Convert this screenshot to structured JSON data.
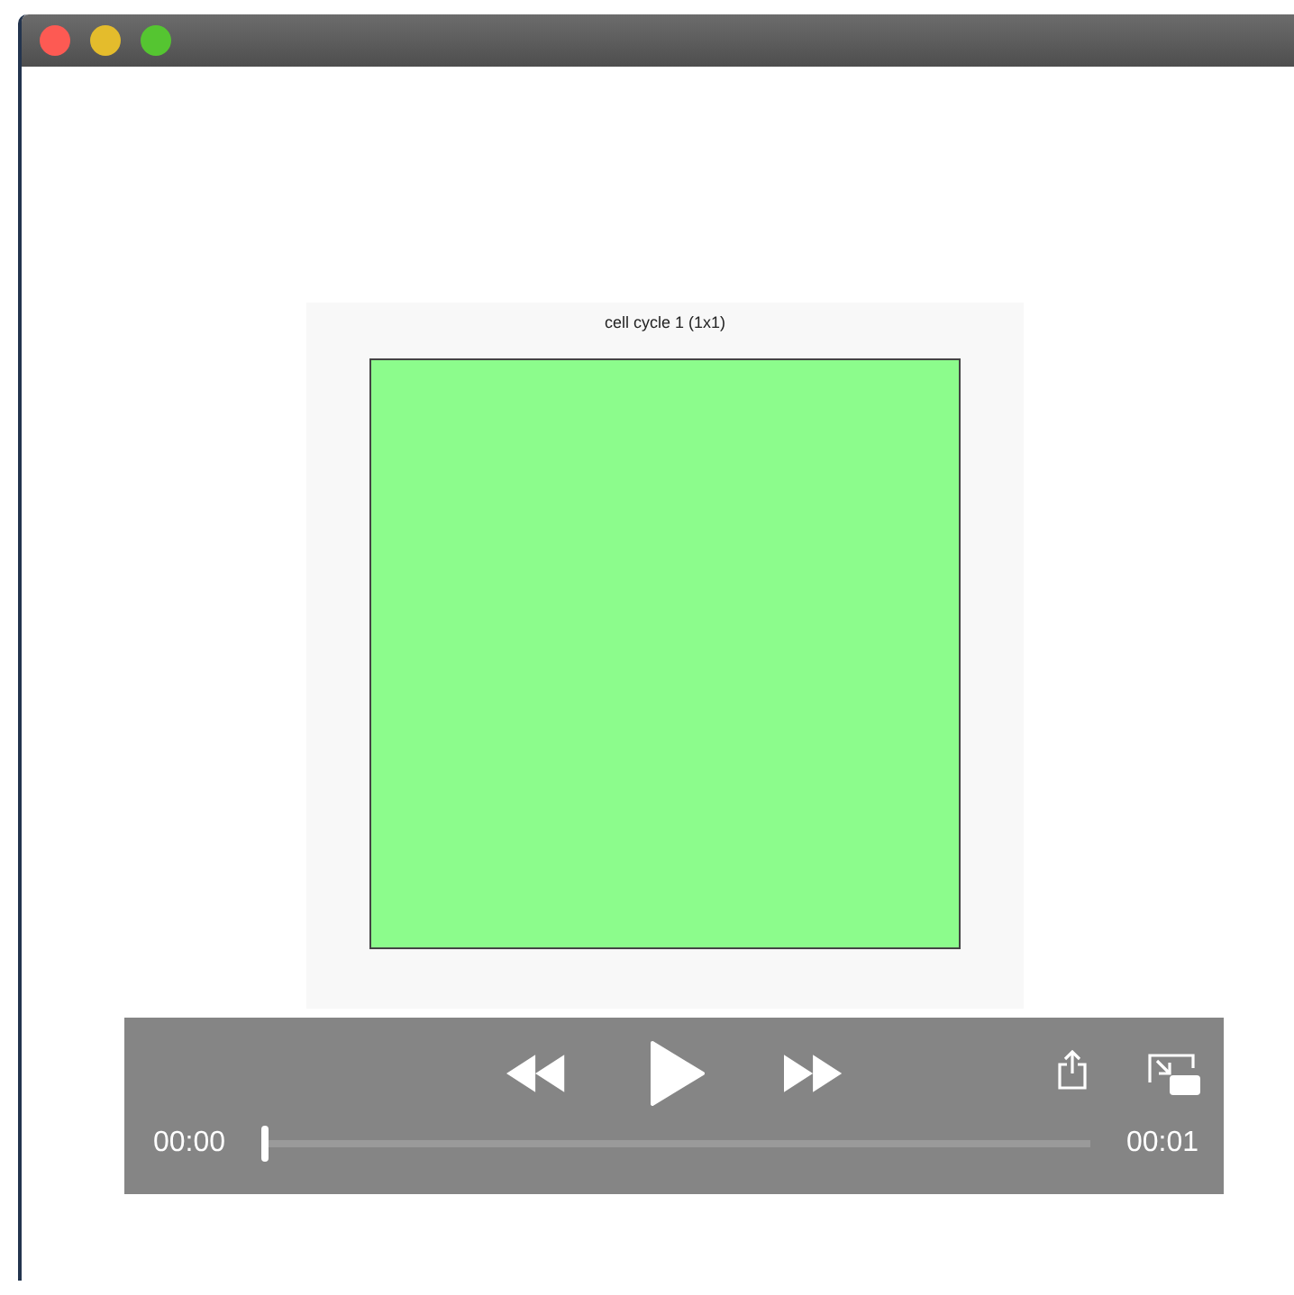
{
  "figure": {
    "title": "cell cycle 1 (1x1)"
  },
  "player": {
    "current_time": "00:00",
    "duration": "00:01",
    "level": 0
  }
}
